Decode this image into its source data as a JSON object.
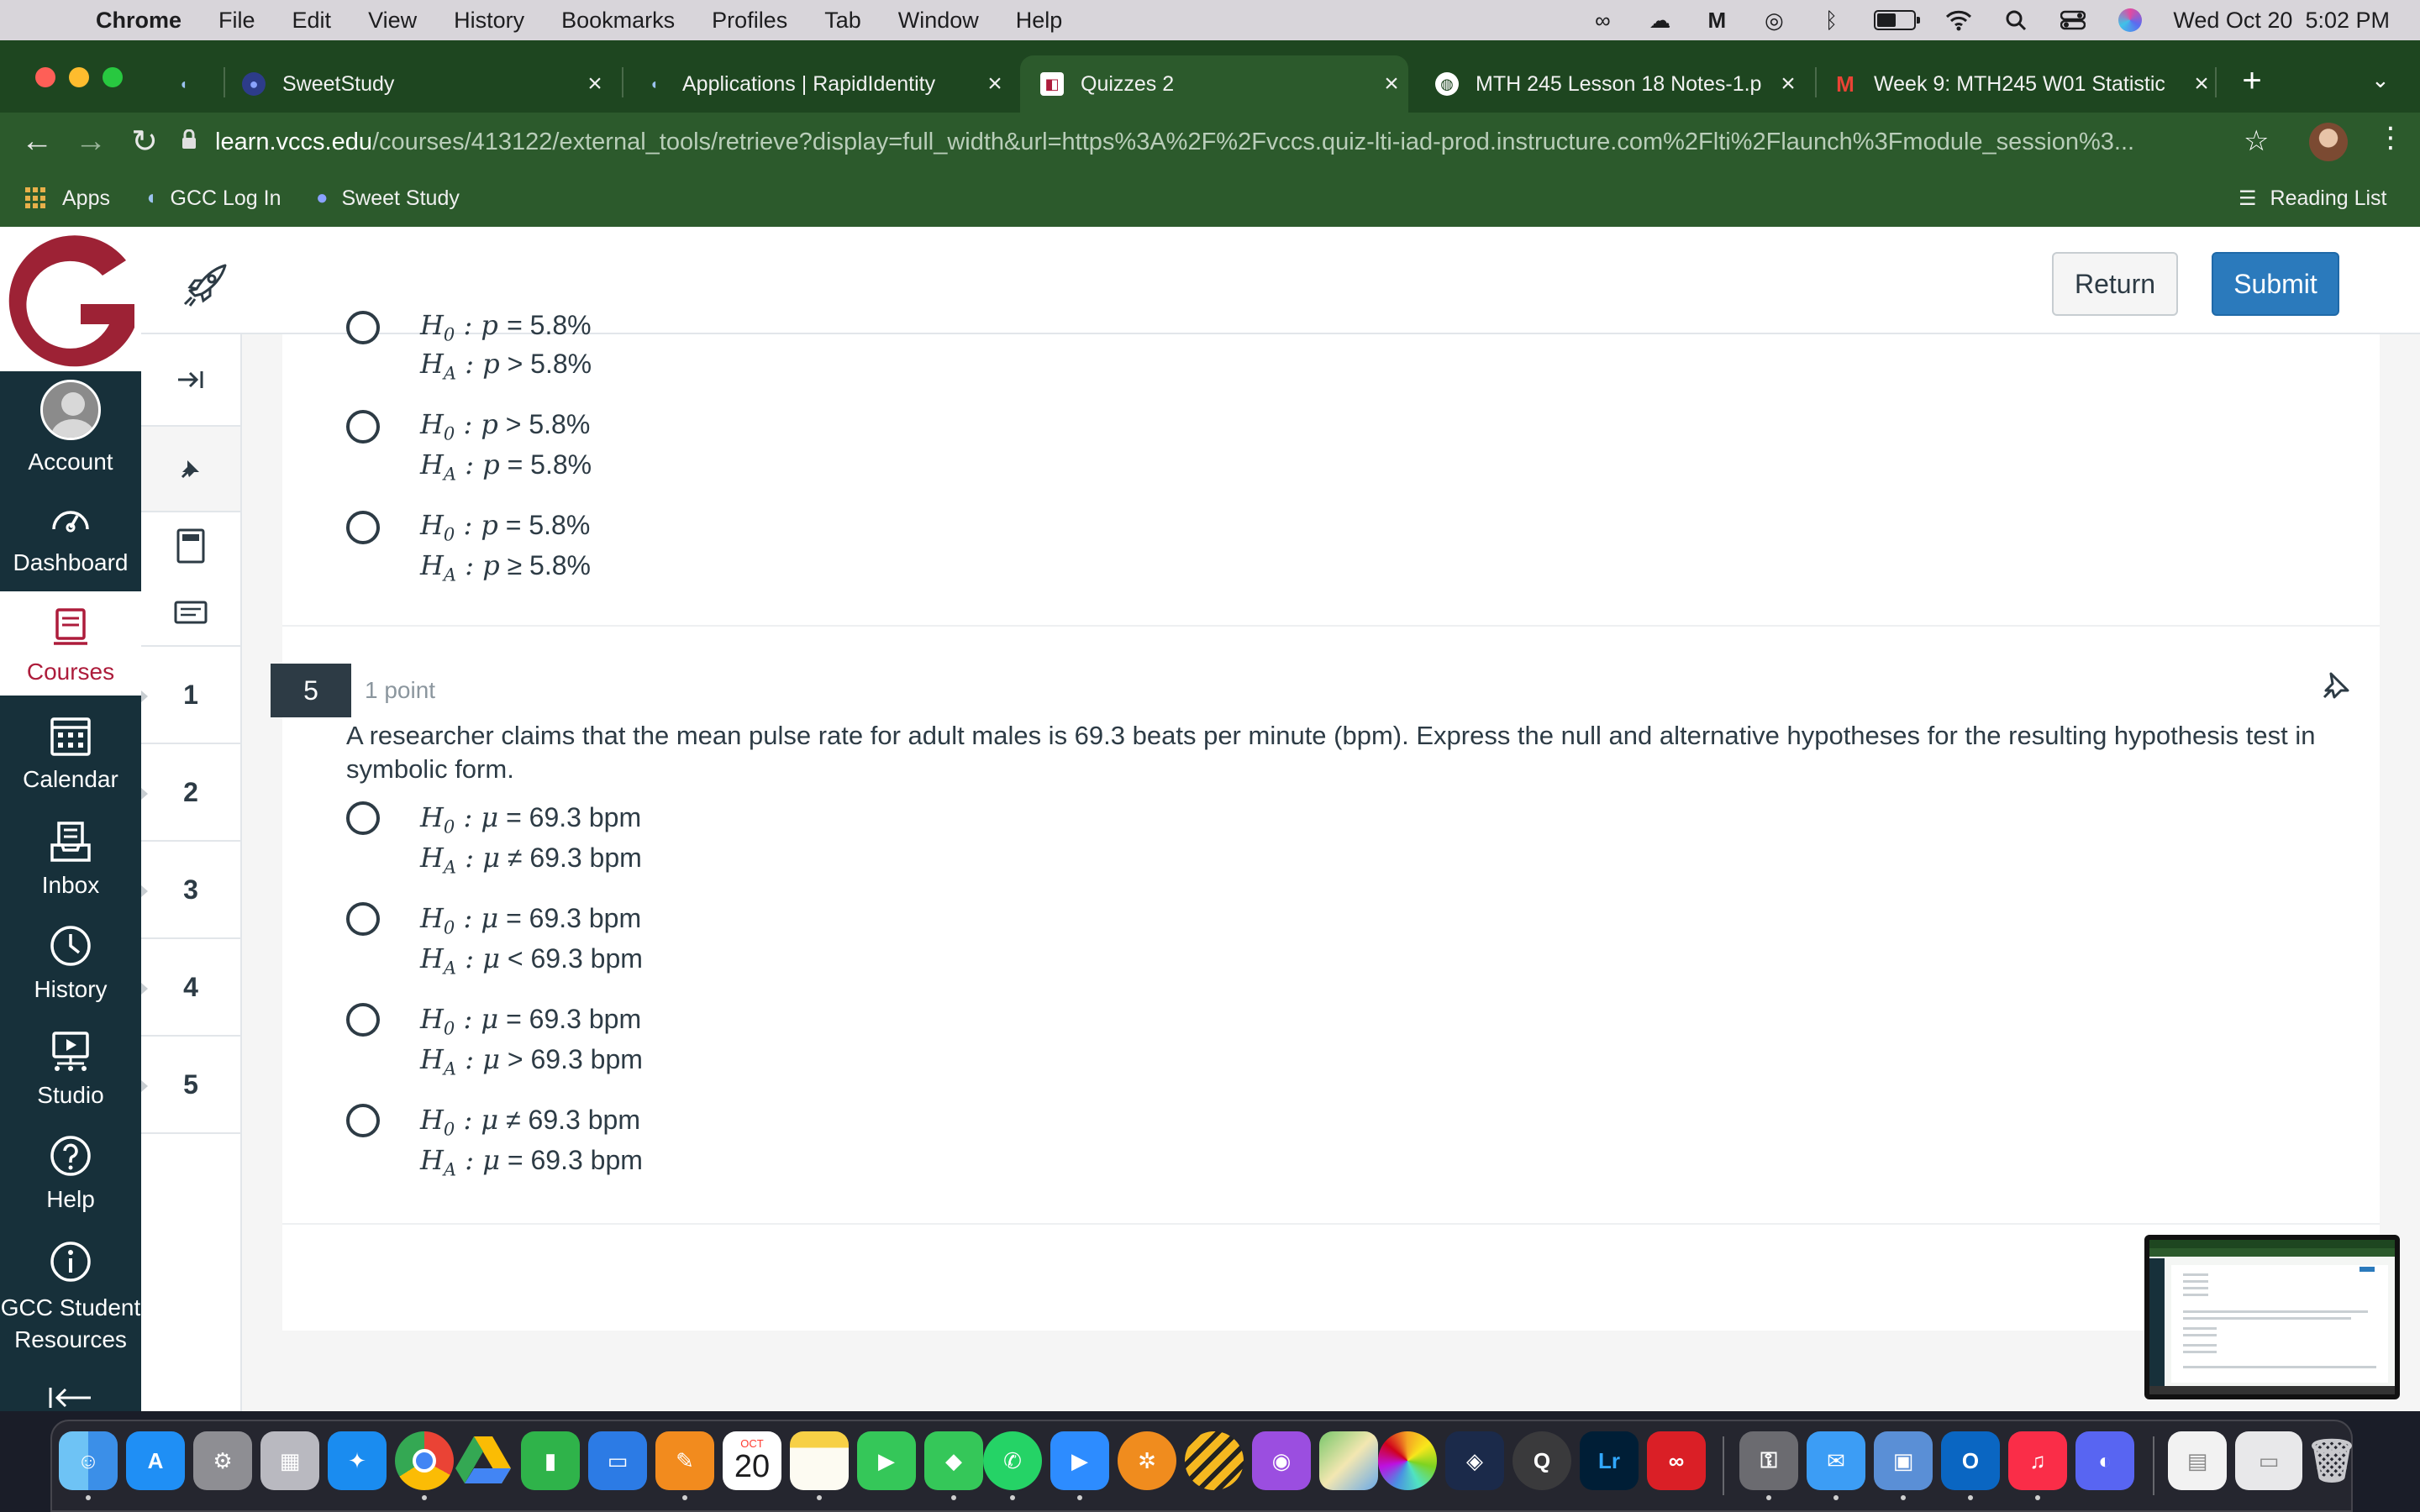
{
  "menubar": {
    "app_name": "Chrome",
    "items": [
      "File",
      "Edit",
      "View",
      "History",
      "Bookmarks",
      "Profiles",
      "Tab",
      "Window",
      "Help"
    ],
    "clock": "Wed Oct 20  5:02 PM"
  },
  "browser": {
    "tabs": [
      {
        "label": "",
        "favicon": "gcc-flame-icon"
      },
      {
        "label": "SweetStudy",
        "favicon": "sweetstudy-icon"
      },
      {
        "label": "Applications | RapidIdentity",
        "favicon": "rapididentity-icon"
      },
      {
        "label": "Quizzes 2",
        "favicon": "canvas-icon",
        "active": true
      },
      {
        "label": "MTH 245 Lesson 18 Notes-1.p",
        "favicon": "globe-icon"
      },
      {
        "label": "Week 9: MTH245 W01 Statistic",
        "favicon": "gmail-icon"
      }
    ],
    "url_host": "learn.vccs.edu",
    "url_path": "/courses/413122/external_tools/retrieve?display=full_width&url=https%3A%2F%2Fvccs.quiz-lti-iad-prod.instructure.com%2Flti%2Flaunch%3Fmodule_session%3...",
    "bookmarks": [
      {
        "label": "Apps",
        "icon": "apps-grid-icon"
      },
      {
        "label": "GCC Log In",
        "icon": "gcc-flame-icon"
      },
      {
        "label": "Sweet Study",
        "icon": "sweetstudy-icon"
      }
    ],
    "reading_list": "Reading List"
  },
  "header": {
    "return_label": "Return",
    "submit_label": "Submit"
  },
  "global_nav": {
    "items": [
      {
        "label": "Account",
        "icon": "avatar-icon"
      },
      {
        "label": "Dashboard",
        "icon": "dashboard-icon"
      },
      {
        "label": "Courses",
        "icon": "courses-icon",
        "active": true
      },
      {
        "label": "Calendar",
        "icon": "calendar-icon"
      },
      {
        "label": "Inbox",
        "icon": "inbox-icon"
      },
      {
        "label": "History",
        "icon": "history-icon"
      },
      {
        "label": "Studio",
        "icon": "studio-icon"
      },
      {
        "label": "Help",
        "icon": "help-icon"
      },
      {
        "label": "GCC Student Resources",
        "icon": "info-icon"
      }
    ],
    "colors": {
      "bg": "#17303a",
      "active_text": "#ad1c3b"
    }
  },
  "question_nav": {
    "numbers": [
      "1",
      "2",
      "3",
      "4",
      "5"
    ]
  },
  "previous_question": {
    "choices": [
      {
        "h0": "= 5.8%",
        "ha": "> 5.8%"
      },
      {
        "h0": "> 5.8%",
        "ha": "= 5.8%"
      },
      {
        "h0": "= 5.8%",
        "ha": "≥ 5.8%"
      }
    ],
    "var": "p"
  },
  "question": {
    "number": "5",
    "points": "1 point",
    "text": "A researcher claims that the mean pulse rate for adult males is 69.3 beats per minute (bpm). Express the null and alternative hypotheses for the resulting hypothesis test in symbolic form.",
    "var": "μ",
    "choices": [
      {
        "h0": "= 69.3 bpm",
        "ha": "≠ 69.3 bpm"
      },
      {
        "h0": "= 69.3 bpm",
        "ha": "< 69.3 bpm"
      },
      {
        "h0": "= 69.3 bpm",
        "ha": "> 69.3 bpm"
      },
      {
        "h0": "≠ 69.3 bpm",
        "ha": "= 69.3 bpm"
      }
    ]
  },
  "dock": {
    "calendar_month": "OCT",
    "calendar_day": "20",
    "lightroom": "Lr"
  },
  "accent_colors": {
    "chrome_green": "#2c5a2c",
    "submit_blue": "#2b7abc",
    "canvas_red": "#ad1c3b"
  }
}
